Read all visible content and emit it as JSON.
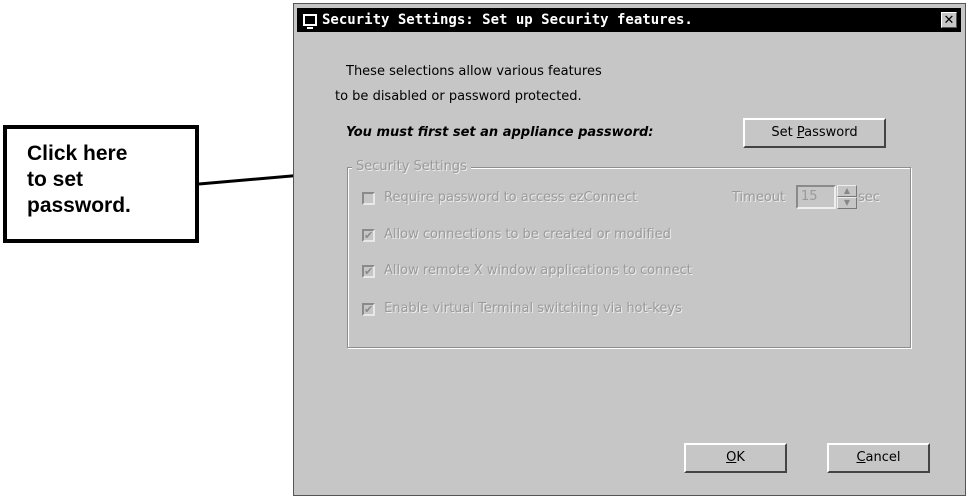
{
  "callout": {
    "lines": [
      "Click here",
      "to set",
      "password."
    ]
  },
  "window": {
    "title": "Security Settings: Set up Security features.",
    "close_glyph": "✕",
    "intro_line1": "These selections allow various features",
    "intro_line2": "to be disabled or password protected.",
    "must_set": "You must first set an appliance password:",
    "set_password": {
      "before": "Set ",
      "mnemonic": "P",
      "after": "assword"
    },
    "group_title": "Security Settings",
    "options": [
      {
        "label": "Require password to access ezConnect",
        "checked": false
      },
      {
        "label": "Allow connections to be created or modified",
        "checked": true
      },
      {
        "label": "Allow remote X window applications to connect",
        "checked": true
      },
      {
        "label": "Enable virtual Terminal switching via hot-keys",
        "checked": true
      }
    ],
    "timeout": {
      "label": "Timeout",
      "value": "15",
      "unit": "sec"
    },
    "ok": {
      "mnemonic": "O",
      "after": "K"
    },
    "cancel": {
      "mnemonic": "C",
      "after": "ancel"
    }
  }
}
